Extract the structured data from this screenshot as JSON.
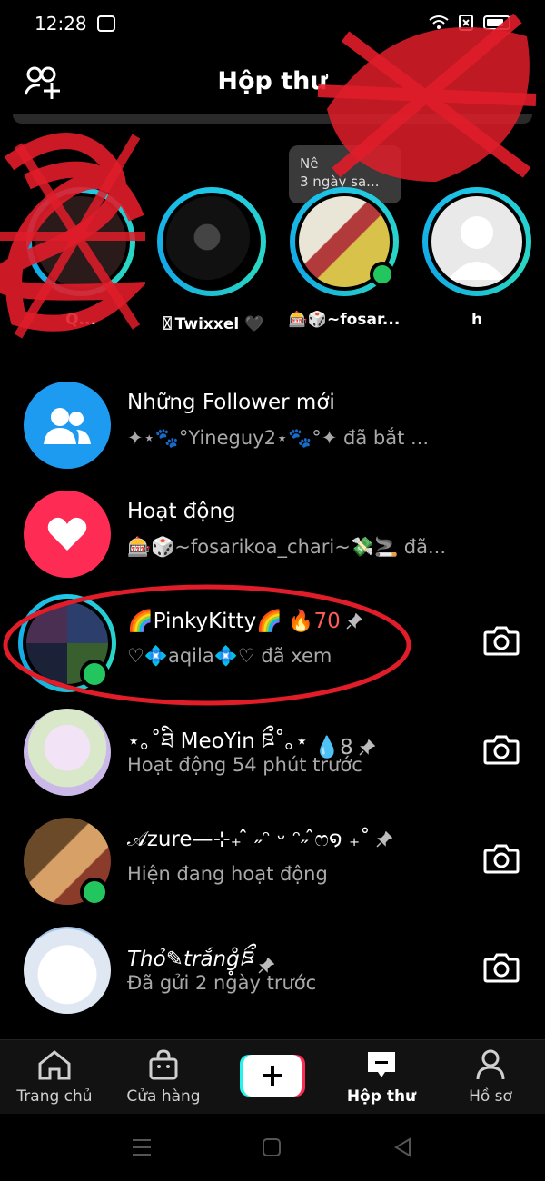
{
  "status": {
    "time": "12:28"
  },
  "header": {
    "title": "Hộp thư"
  },
  "stories": {
    "tooltip": {
      "line1": "Nê",
      "line2": "3 ngày sa..."
    },
    "items": [
      {
        "name": "Q..."
      },
      {
        "name": "〿Twixxel 🖤"
      },
      {
        "name": "🎰🎲~fosar..."
      },
      {
        "name": "h"
      }
    ]
  },
  "rows": [
    {
      "name": "Những Follower mới",
      "sub": "✦⋆🐾°Yineguy2⋆🐾°✦ đã bắt ..."
    },
    {
      "name": "Hoạt động",
      "sub": "🎰🎲~fosarikoa_chari~💸🚬 đã..."
    },
    {
      "name": "🌈PinkyKitty🌈",
      "streak": "🔥70",
      "sub": "♡💠aqila💠♡ đã xem"
    },
    {
      "name": "⋆｡˚ཐི MeoYin ཋྀ˚｡⋆",
      "streak": "💧8",
      "sub": "Hoạt động 54 phút trước"
    },
    {
      "name": "𝒜zure—⊹₊ ̂ ˶ᵔ ᵕ ᵔ˶ ̂ෆ໑ ₊˚",
      "sub": "Hiện đang hoạt động"
    },
    {
      "name": "Thỏ✎trắng̥̊ཋྀ",
      "sub": "Đã gửi 2 ngày trước"
    }
  ],
  "nav": {
    "home": "Trang chủ",
    "shop": "Cửa hàng",
    "inbox": "Hộp thư",
    "profile": "Hồ sơ"
  },
  "colors": {
    "ring": "#1fc7e6",
    "online": "#22c55e",
    "followers": "#1d9bf0",
    "activity": "#fe2c55",
    "annotation": "#e11d2a"
  }
}
